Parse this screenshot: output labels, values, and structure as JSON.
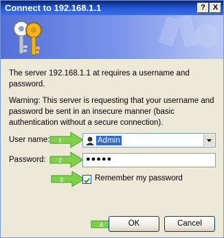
{
  "window": {
    "title": "Connect to 192.168.1.1",
    "help_glyph": "?",
    "close_glyph": "X"
  },
  "body": {
    "message": "The server 192.168.1.1 at  requires a username and password.",
    "warning": "Warning: This server is requesting that your username and password be sent in an insecure manner (basic authentication without a secure connection)."
  },
  "form": {
    "username_label": "User name:",
    "username_value": "Admin",
    "password_label": "Password:",
    "password_mask": "●●●●●",
    "remember_label": "Remember my password",
    "remember_checked": true
  },
  "buttons": {
    "ok": "OK",
    "cancel": "Cancel"
  },
  "steps": [
    "1",
    "2",
    "3",
    "4"
  ],
  "colors": {
    "titlebar": "#0a246a",
    "banner": "#5470d8",
    "dialog_bg": "#ece9d8",
    "step_arrow": "#7fd14a",
    "selection": "#316ac5"
  },
  "icons": {
    "banner": "keys-icon",
    "user": "user-icon"
  }
}
